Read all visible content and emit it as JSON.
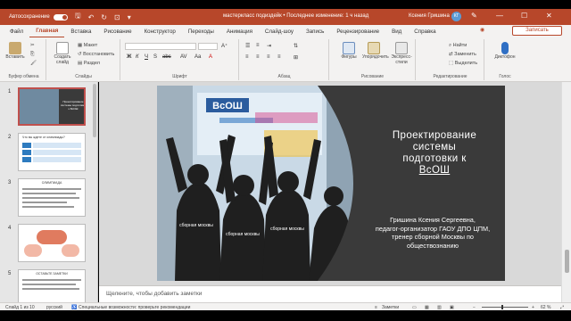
{
  "titlebar": {
    "autosave_label": "Автосохранение",
    "doc_title": "мастеркласс подиздейк • Последнее изменение: 1 ч назад",
    "user_name": "Ксения Гришина",
    "user_initials": "КГ"
  },
  "menu": {
    "items": [
      "Файл",
      "Главная",
      "Вставка",
      "Рисование",
      "Конструктор",
      "Переходы",
      "Анимация",
      "Слайд-шоу",
      "Запись",
      "Рецензирование",
      "Вид",
      "Справка"
    ],
    "active": "Главная",
    "record": "◉",
    "share": "Записать"
  },
  "ribbon": {
    "clipboard": {
      "paste": "Вставить",
      "label": "Буфер обмена"
    },
    "slides": {
      "new_slide": "Создать слайд",
      "layout": "Макет",
      "reset": "Восстановить",
      "section": "Раздел",
      "label": "Слайды"
    },
    "font": {
      "label": "Шрифт"
    },
    "paragraph": {
      "label": "Абзац"
    },
    "drawing": {
      "shapes": "Фигуры",
      "arrange": "Упорядочить",
      "quick_styles": "Экспресс-стили",
      "label": "Рисование"
    },
    "editing": {
      "find": "Найти",
      "replace": "Заменить",
      "select": "Выделить",
      "label": "Редактирование"
    },
    "voice": {
      "dictate": "Диктофон",
      "label": "Голос"
    }
  },
  "thumbnails": [
    {
      "num": "1",
      "title": "Проектирование системы подготовки к ВсОШ"
    },
    {
      "num": "2",
      "title": "Что вы ждете от олимпиады?"
    },
    {
      "num": "3",
      "title": "ОЛИМПИАДА"
    },
    {
      "num": "4",
      "title": ""
    },
    {
      "num": "5",
      "title": "ОСТАВЬТЕ ЗАМЕТКИ"
    }
  ],
  "slide": {
    "title_lines": [
      "Проектирование",
      "системы",
      "подготовки к",
      "ВсОШ"
    ],
    "sub_lines": [
      "Гришина Ксения Сергеевна,",
      "педагог-организатор ГАОУ ДПО ЦПМ,",
      "тренер сборной Москвы по",
      "обществознанию"
    ],
    "photo_sign": "ВсОШ",
    "hoodie_text": "сборная москвы"
  },
  "notes": {
    "placeholder": "Щелкните, чтобы добавить заметки"
  },
  "status": {
    "slide_info": "Слайд 1 из 10",
    "language": "русский",
    "accessibility": "Специальные возможности: проверьте рекомендации",
    "notes_btn": "Заметки",
    "zoom": "62 %"
  }
}
